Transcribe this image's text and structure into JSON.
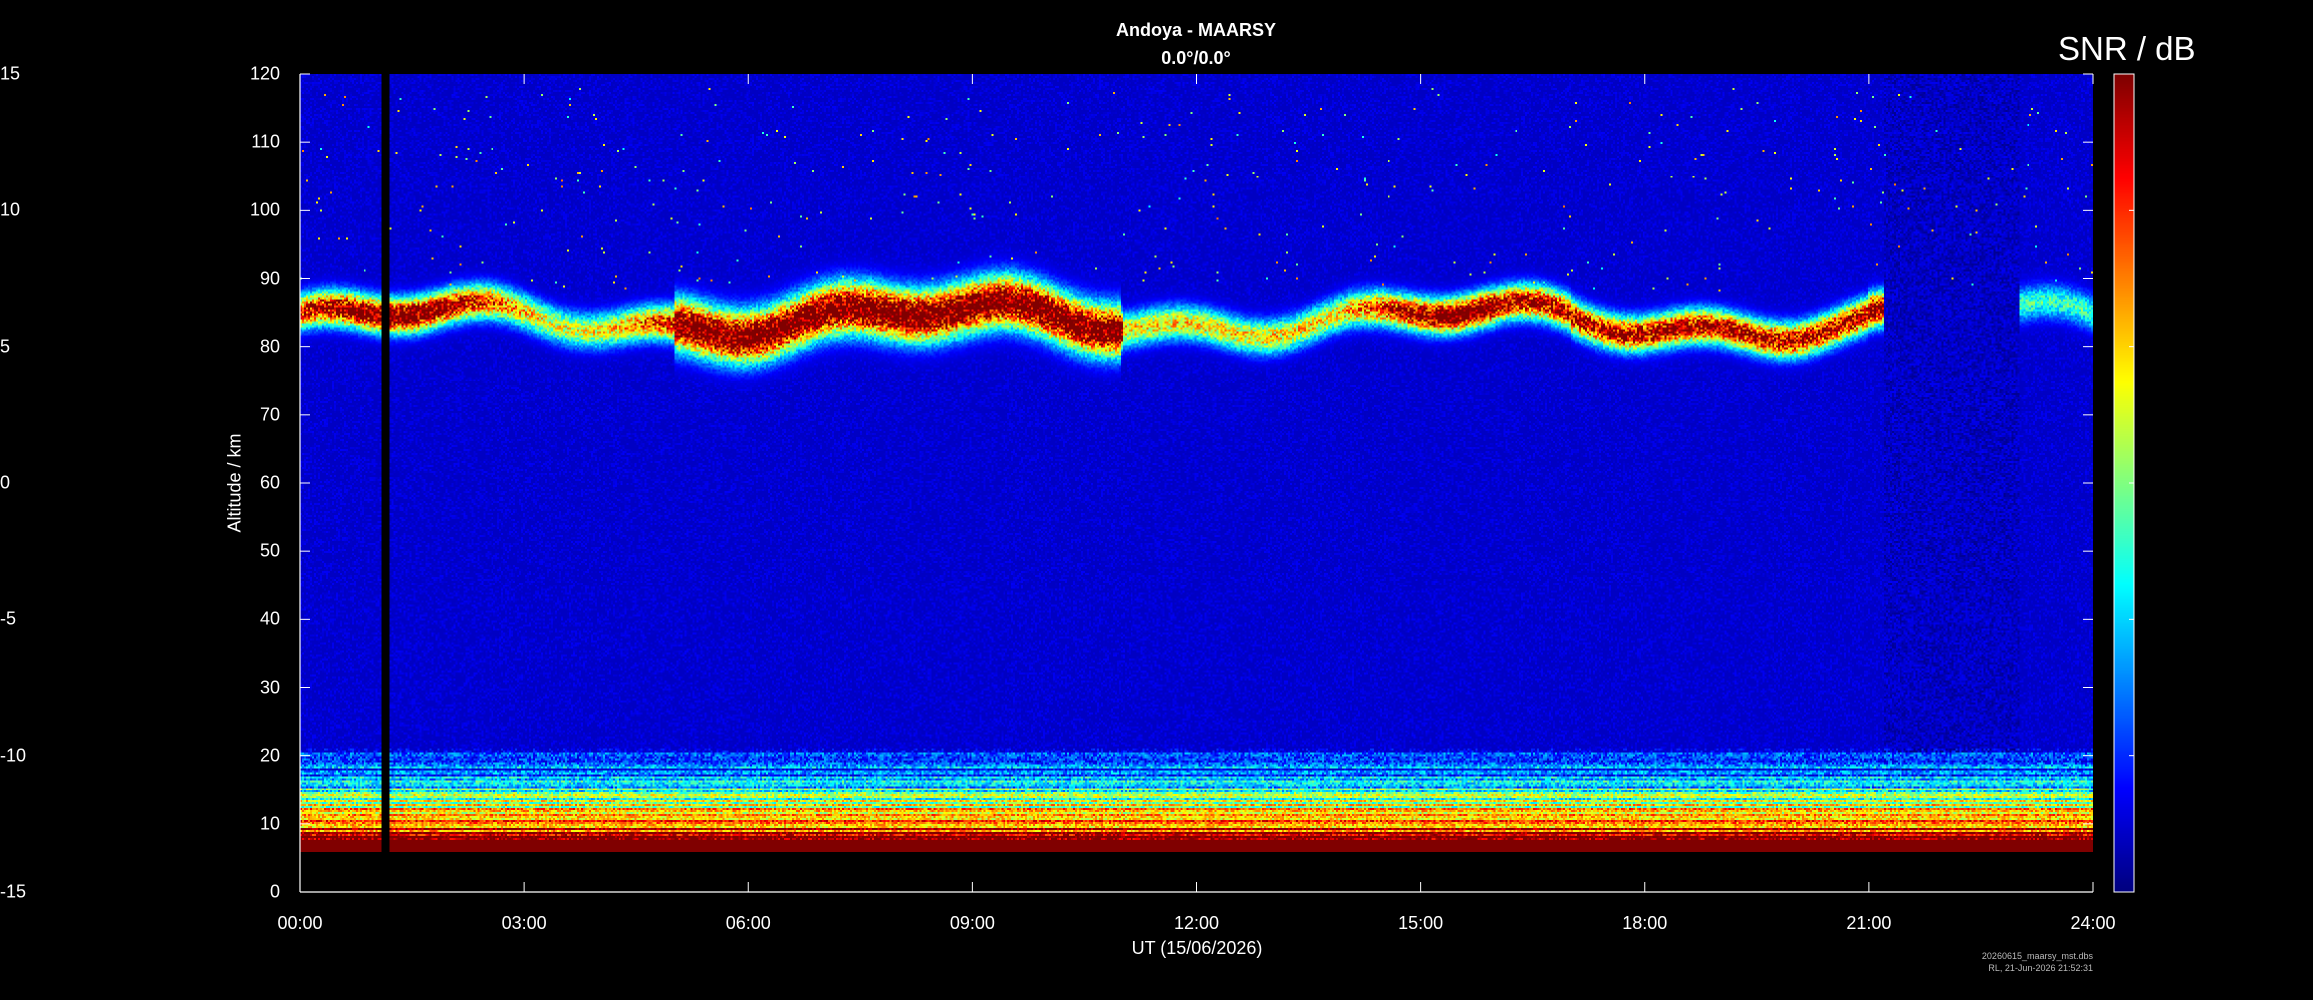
{
  "chart_data": {
    "type": "heatmap",
    "title": "Andoya - MAARSY",
    "subtitle": "0.0°/0.0°",
    "xlabel": "UT (15/06/2026)",
    "ylabel": "Altitude / km",
    "colorbar_label": "SNR / dB",
    "x_tick_labels": [
      "00:00",
      "03:00",
      "06:00",
      "09:00",
      "12:00",
      "15:00",
      "18:00",
      "21:00",
      "24:00"
    ],
    "xlim": [
      0,
      24
    ],
    "y_ticks": [
      0,
      10,
      20,
      30,
      40,
      50,
      60,
      70,
      80,
      90,
      100,
      110,
      120
    ],
    "ylim": [
      0,
      120
    ],
    "colorbar_ticks": [
      -15,
      -10,
      -5,
      0,
      5,
      10,
      15
    ],
    "clim": [
      -15,
      15
    ],
    "colormap": "jet",
    "data_coverage_altitude_km": [
      6,
      120
    ],
    "data_gap_ut_hours": [
      1.1,
      1.2
    ],
    "features": [
      {
        "name": "PMSE layer",
        "altitude_km": [
          80,
          90
        ],
        "time_ut_hours": [
          0,
          21.2
        ],
        "peak_snr_db": 15
      },
      {
        "name": "Tropospheric/stratospheric echoes",
        "altitude_km": [
          6,
          20
        ],
        "time_ut_hours": [
          0,
          24
        ],
        "peak_snr_db": 15
      }
    ],
    "grid": false,
    "background_snr_db": -13
  },
  "footer": {
    "line1": "20260615_maarsy_mst.dbs",
    "line2": "RL, 21-Jun-2026 21:52:31"
  }
}
